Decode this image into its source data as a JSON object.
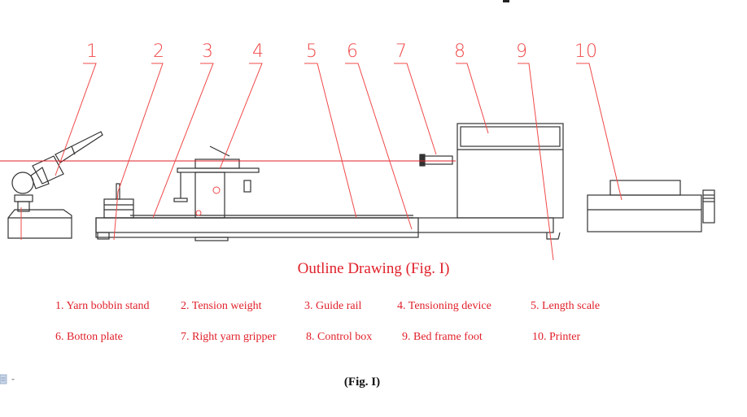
{
  "figure": {
    "caption": "Outline Drawing (Fig. I)",
    "fig_label": "(Fig. I)",
    "accent_color": "#e0202a",
    "line_color": "#333333"
  },
  "callouts": [
    {
      "number": "1",
      "label": "Yarn bobbin stand"
    },
    {
      "number": "2",
      "label": "Tension weight"
    },
    {
      "number": "3",
      "label": "Guide rail"
    },
    {
      "number": "4",
      "label": "Tensioning device"
    },
    {
      "number": "5",
      "label": "Length scale"
    },
    {
      "number": "6",
      "label": "Botton plate"
    },
    {
      "number": "7",
      "label": "Right yarn gripper"
    },
    {
      "number": "8",
      "label": "Control box"
    },
    {
      "number": "9",
      "label": "Bed frame foot"
    },
    {
      "number": "10",
      "label": "Printer"
    }
  ],
  "legend": [
    "1. Yarn bobbin stand",
    "2. Tension weight",
    "3. Guide rail",
    "4. Tensioning device",
    "5. Length scale",
    "6. Botton plate",
    "7. Right yarn gripper",
    "8. Control box",
    "9. Bed frame foot",
    "10. Printer"
  ],
  "toolbar": {
    "icon": "paste-options-icon"
  }
}
